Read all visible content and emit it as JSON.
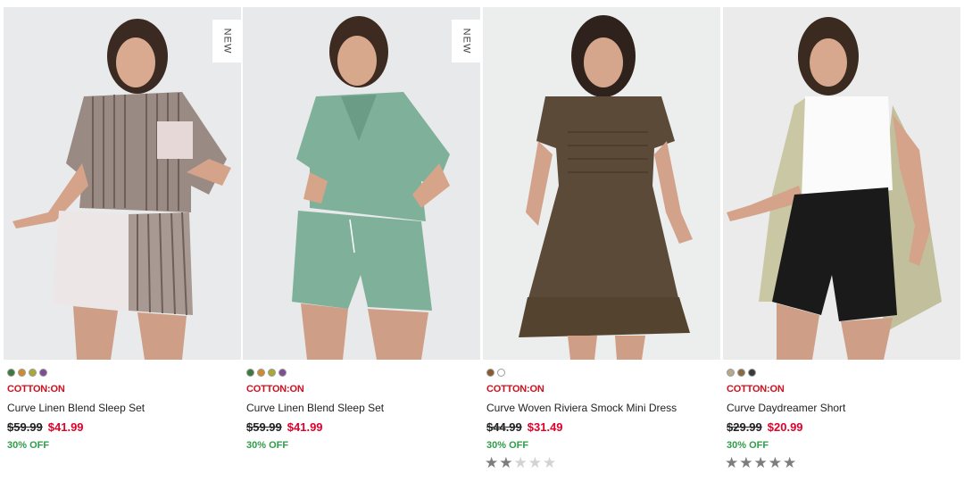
{
  "products": [
    {
      "badge": "NEW",
      "swatches": [
        "#3b7a3f",
        "#d18b2e",
        "#a9a936",
        "#7d4e94"
      ],
      "brand": "COTTON:ON",
      "name": "Curve Linen Blend Sleep Set",
      "old_price": "$59.99",
      "price": "$41.99",
      "discount": "30% OFF",
      "rating": null
    },
    {
      "badge": "NEW",
      "swatches": [
        "#3b7a3f",
        "#d18b2e",
        "#a9a936",
        "#7d4e94"
      ],
      "brand": "COTTON:ON",
      "name": "Curve Linen Blend Sleep Set",
      "old_price": "$59.99",
      "price": "$41.99",
      "discount": "30% OFF",
      "rating": null
    },
    {
      "badge": "",
      "swatches": [
        "#8a5a2b",
        "#ffffff"
      ],
      "brand": "COTTON:ON",
      "name": "Curve Woven Riviera Smock Mini Dress",
      "old_price": "$44.99",
      "price": "$31.49",
      "discount": "30% OFF",
      "rating": 2
    },
    {
      "badge": "",
      "swatches": [
        "#b7a98c",
        "#8a6a3c",
        "#3a3a3a"
      ],
      "brand": "COTTON:ON",
      "name": "Curve Daydreamer Short",
      "old_price": "$29.99",
      "price": "$20.99",
      "discount": "30% OFF",
      "rating": 5
    }
  ]
}
